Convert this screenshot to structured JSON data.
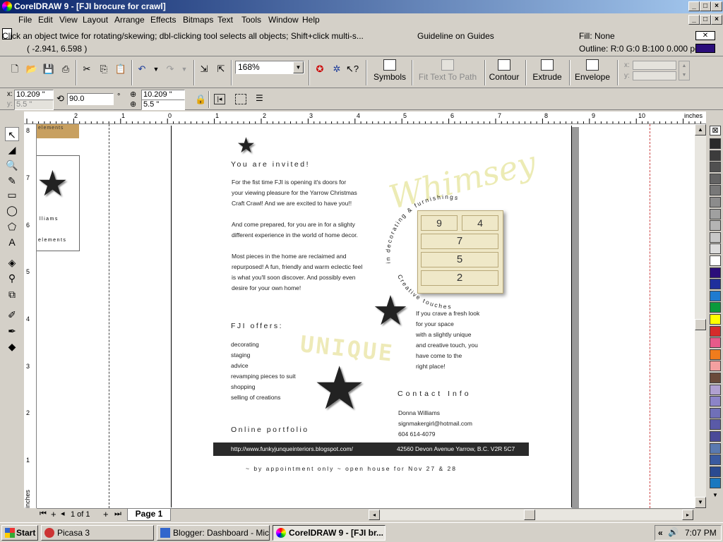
{
  "window": {
    "title": "CorelDRAW 9 - [FJI brocure for crawl]"
  },
  "menu": [
    "File",
    "Edit",
    "View",
    "Layout",
    "Arrange",
    "Effects",
    "Bitmaps",
    "Text",
    "Tools",
    "Window",
    "Help"
  ],
  "status": {
    "hint": "Click an object twice for rotating/skewing; dbl-clicking tool selects all objects; Shift+click multi-s...",
    "coords": "( -2.941, 6.598 )",
    "guides": "Guideline on Guides",
    "fill": "Fill: None",
    "outline": "Outline: R:0 G:0 B:100  0.000 poin"
  },
  "toolbar": {
    "zoom": "168%",
    "symbols": "Symbols",
    "fit_text": "Fit Text To Path",
    "contour": "Contour",
    "extrude": "Extrude",
    "envelope": "Envelope",
    "x_label": "x:",
    "y_label": "y:"
  },
  "props": {
    "x_label": "x:",
    "x": "10.209 \"",
    "y_label": "y:",
    "y": "5.5 \"",
    "rotation": "90.0",
    "deg": "°",
    "w": "10.209 \"",
    "h": "5.5 \""
  },
  "ruler": {
    "h_ticks": [
      "2",
      "1",
      "0",
      "1",
      "2",
      "3",
      "4",
      "5",
      "6",
      "7",
      "8",
      "9",
      "10"
    ],
    "h_unit": "inches",
    "v_ticks": [
      "8",
      "7",
      "6",
      "5",
      "4",
      "3",
      "2",
      "1"
    ],
    "v_unit": "inches"
  },
  "side_fragment": {
    "a": "elements",
    "b": "lliams",
    "c": "elements"
  },
  "doc": {
    "invited": "You are invited!",
    "p1": [
      "For the fist time FJI is opening it's doors for",
      "your viewing pleasure for the Yarrow Christmas",
      "Craft Crawl! And we are excited to have you!!"
    ],
    "p2": [
      "And come prepared, for you are in for a slighty",
      "different experience in the world of home decor."
    ],
    "p3": [
      "Most pieces in the home are reclaimed and",
      "repurposed! A fun, friendly and warm eclectic feel",
      "is what you'll soon discover. And possibly even",
      "desire for your own home!"
    ],
    "logo": "Whimsey",
    "arc_top": "in decorating & furnishings",
    "arc_bottom": "Creative touches",
    "drawers": [
      "9",
      "4",
      "7",
      "5",
      "2"
    ],
    "offers_title": "FJI offers:",
    "offers": [
      "decorating",
      "staging",
      "advice",
      "revamping pieces to suit",
      "shopping",
      "selling of creations"
    ],
    "unique": "UNIQUE",
    "crave": [
      "If you crave a fresh look",
      "for your space",
      "with a slightly unique",
      "and creative touch, you",
      "have come to the",
      "right place!"
    ],
    "contact_title": "Contact Info",
    "contact": [
      "Donna Williams",
      "signmakergirl@hotmail.com",
      "604 614-4079"
    ],
    "portfolio": "Online portfolio",
    "url": "http://www.funkyjunqueinteriors.blogspot.com/",
    "address": "42560 Devon Avenue Yarrow, B.C. V2R 5C7",
    "footer": "~ by appointment only ~ open house for Nov 27 & 28"
  },
  "pagebar": {
    "count": "1 of 1",
    "tab": "Page 1"
  },
  "palette": [
    "#2a2a2a",
    "#3c3c3c",
    "#505050",
    "#646464",
    "#787878",
    "#8c8c8c",
    "#a0a0a0",
    "#b4b4b4",
    "#c8c8c8",
    "#dcdcdc",
    "#ffffff",
    "#2b0e7a",
    "#1f2f9c",
    "#1f7bd0",
    "#0b9a3c",
    "#ffff00",
    "#d62b2b",
    "#e85a8a",
    "#f07c1c",
    "#f4a0a0",
    "#6a4a3a",
    "#b0a0d0",
    "#8c84c8",
    "#7070b8",
    "#5a5aa8",
    "#4a4a98",
    "#5a7ab0",
    "#3a5aa0",
    "#2a4a90",
    "#1a78c0"
  ],
  "taskbar": {
    "start": "Start",
    "tasks": [
      "Picasa 3",
      "Blogger: Dashboard - Mic...",
      "CorelDRAW 9 - [FJI br..."
    ],
    "clock": "7:07 PM",
    "tray": "«"
  },
  "colors": {
    "title_start": "#0a246a",
    "title_end": "#a6caf0",
    "outline_swatch": "#2b0e7a",
    "banner": "#2a2a2a"
  }
}
